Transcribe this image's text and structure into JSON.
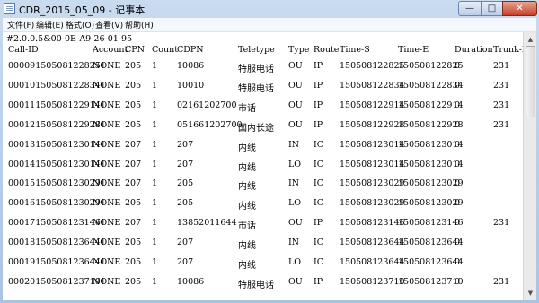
{
  "window": {
    "title": "CDR_2015_05_09 - 记事本"
  },
  "title_buttons": {
    "minimize": "—",
    "maximize": "□",
    "close": "✕"
  },
  "menu": [
    "文件(F)",
    "编辑(E)",
    "格式(O)",
    "查看(V)",
    "帮助(H)"
  ],
  "content": {
    "first_line": "#2.0.0.5&00-0E-A9-26-01-95",
    "headers": [
      "Call-ID",
      "Account",
      "CPN",
      "Count",
      "CDPN",
      "Teletype",
      "Type",
      "Route",
      "Time-S",
      "Time-E",
      "Duration",
      "Trunk-N"
    ],
    "rows": [
      [
        "000091505081228251",
        "NONE",
        "205",
        "1",
        "10086",
        "特服电话",
        "OU",
        "IP",
        "150508122825",
        "150508122825",
        "0",
        "231"
      ],
      [
        "000101505081228341",
        "NONE",
        "205",
        "1",
        "10010",
        "特服电话",
        "OU",
        "IP",
        "150508122834",
        "150508122834",
        "0",
        "231"
      ],
      [
        "000111505081229141",
        "NONE",
        "205",
        "1",
        "02161202700",
        "市话",
        "OU",
        "IP",
        "150508122914",
        "150508122914",
        "0",
        "231"
      ],
      [
        "000121505081229281",
        "NONE",
        "205",
        "1",
        "051661202700",
        "国内长途",
        "OU",
        "IP",
        "150508122928",
        "150508122928",
        "0",
        "231"
      ],
      [
        "000131505081230141",
        "NONE",
        "207",
        "1",
        "207",
        "内线",
        "IN",
        "IC",
        "150508123014",
        "150508123014",
        "0",
        ""
      ],
      [
        "000141505081230141",
        "NONE",
        "207",
        "1",
        "207",
        "内线",
        "LO",
        "IC",
        "150508123014",
        "150508123014",
        "0",
        ""
      ],
      [
        "000151505081230291",
        "NONE",
        "207",
        "1",
        "205",
        "内线",
        "IN",
        "IC",
        "150508123029",
        "150508123029",
        "0",
        ""
      ],
      [
        "000161505081230291",
        "NONE",
        "205",
        "1",
        "205",
        "内线",
        "LO",
        "IC",
        "150508123029",
        "150508123029",
        "0",
        ""
      ],
      [
        "000171505081231461",
        "NONE",
        "207",
        "1",
        "13852011644",
        "市话",
        "OU",
        "IP",
        "150508123146",
        "150508123146",
        "0",
        "231"
      ],
      [
        "000181505081236441",
        "NONE",
        "205",
        "1",
        "207",
        "内线",
        "IN",
        "IC",
        "150508123644",
        "150508123644",
        "0",
        ""
      ],
      [
        "000191505081236441",
        "NONE",
        "205",
        "1",
        "207",
        "内线",
        "LO",
        "IC",
        "150508123644",
        "150508123644",
        "0",
        ""
      ],
      [
        "000201505081237101",
        "NONE",
        "205",
        "1",
        "10086",
        "特服电话",
        "OU",
        "IP",
        "150508123710",
        "150508123710",
        "0",
        "231"
      ]
    ]
  }
}
